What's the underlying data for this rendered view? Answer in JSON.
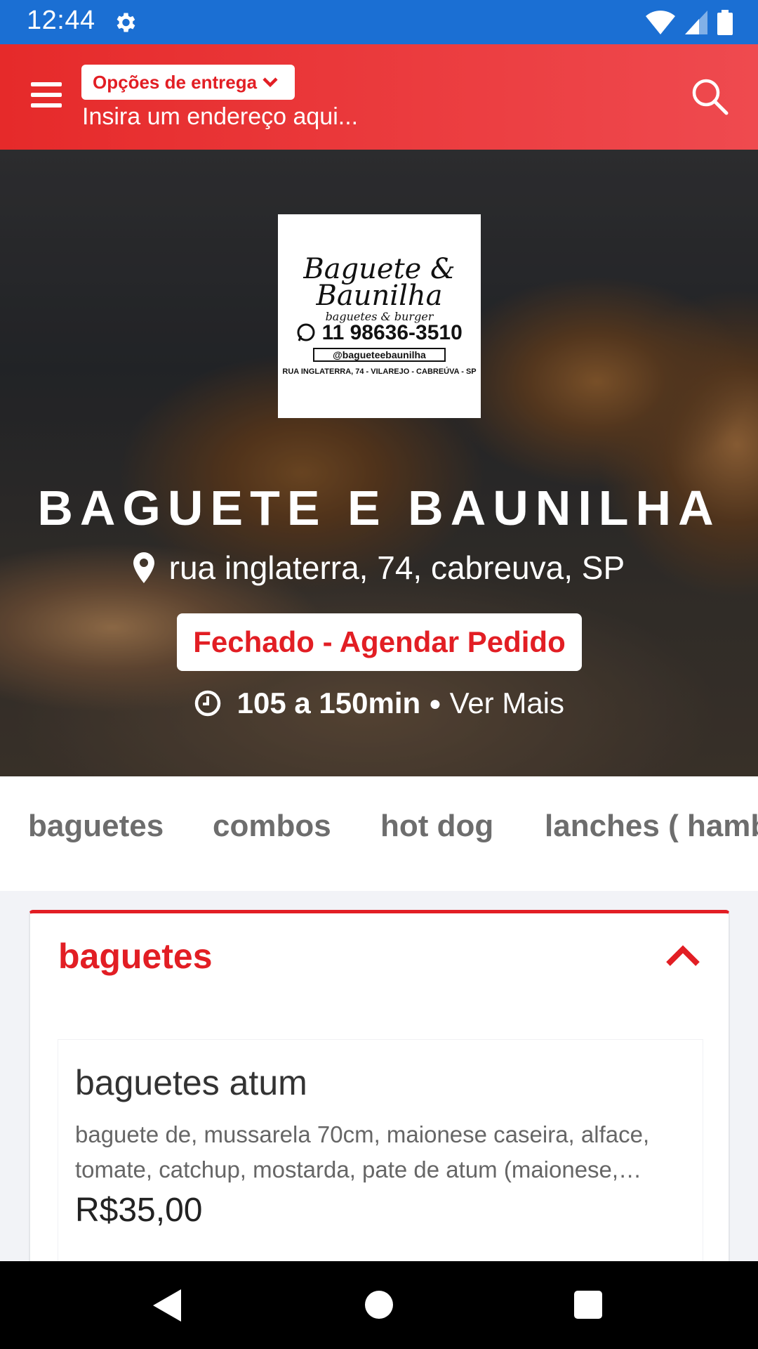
{
  "status_bar": {
    "time": "12:44",
    "icons": [
      "gear-icon",
      "wifi-icon",
      "signal-icon",
      "battery-icon"
    ]
  },
  "app_bar": {
    "delivery_options_label": "Opções de entrega",
    "address_placeholder": "Insira um endereço aqui...",
    "icons": [
      "menu-icon",
      "chevron-down-icon",
      "search-icon"
    ],
    "color": "#e62a2a"
  },
  "hero": {
    "logo": {
      "line1": "Baguete &",
      "line1b": "Baunilha",
      "tagline": "baguetes & burger",
      "phone": "11 98636-3510",
      "social": "@bagueteebaunilha",
      "address": "RUA INGLATERRA, 74 - VILAREJO - CABREÚVA - SP"
    },
    "restaurant_name": "BAGUETE E BAUNILHA",
    "address": "rua inglaterra, 74, cabreuva, SP",
    "status_button": "Fechado - Agendar Pedido",
    "delivery_time": "105 a 150min",
    "separator": "●",
    "see_more": "Ver Mais"
  },
  "tabs": [
    "baguetes",
    "combos",
    "hot dog",
    "lanches ( hamb"
  ],
  "category": {
    "title": "baguetes",
    "accent": "#e21e24",
    "products": [
      {
        "name": "baguetes atum",
        "description": "baguete de, mussarela 70cm, maionese caseira, alface, tomate, catchup, mostarda, pate de atum (maionese,…",
        "price": "R$35,00"
      }
    ]
  },
  "nav_bar": {
    "icons": [
      "back-icon",
      "home-icon",
      "recents-icon"
    ]
  }
}
